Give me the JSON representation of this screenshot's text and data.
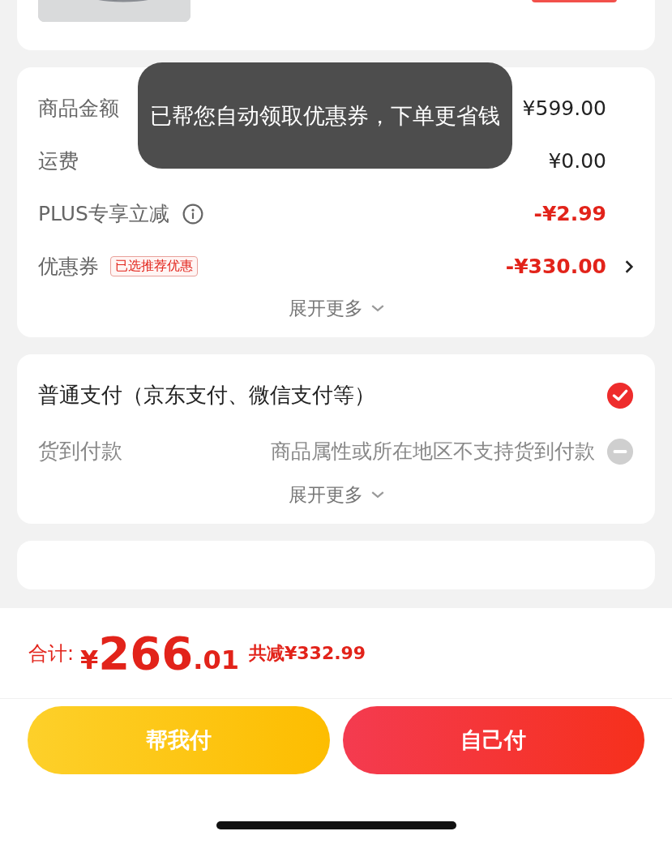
{
  "toast": {
    "text": "已帮您自动领取优惠券，下单更省钱"
  },
  "price_rows": [
    {
      "kind": "plain",
      "label": "商品金额",
      "value": "¥599.00"
    },
    {
      "kind": "plain",
      "label": "运费",
      "value": "¥0.00"
    },
    {
      "kind": "info",
      "label": "PLUS专享立减",
      "value": "-¥2.99"
    },
    {
      "kind": "coupon",
      "label": "优惠券",
      "tag": "已选推荐优惠",
      "value": "-¥330.00"
    }
  ],
  "price_expand": "展开更多",
  "payment_methods": [
    {
      "label": "普通支付（京东支付、微信支付等）",
      "selected": true,
      "disabled": false
    },
    {
      "label": "货到付款",
      "note": "商品属性或所在地区不支持货到付款",
      "selected": false,
      "disabled": true
    }
  ],
  "payment_expand": "展开更多",
  "total": {
    "label": "合计:",
    "currency": "¥",
    "integer": "266",
    "decimal": ".01",
    "saved": "共减¥332.99"
  },
  "buttons": [
    {
      "label": "帮我付",
      "kind": "secondary"
    },
    {
      "label": "自己付",
      "kind": "primary"
    }
  ]
}
